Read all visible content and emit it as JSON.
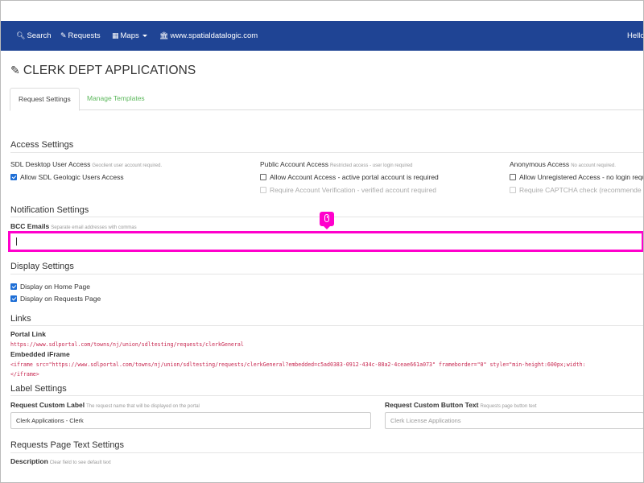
{
  "navbar": {
    "search": "Search",
    "requests": "Requests",
    "maps": "Maps",
    "website": "www.spatialdatalogic.com",
    "greeting": "Hello"
  },
  "page": {
    "title": "CLERK DEPT APPLICATIONS"
  },
  "tabs": [
    {
      "label": "Request Settings",
      "active": true
    },
    {
      "label": "Manage Templates",
      "active": false
    }
  ],
  "access": {
    "heading": "Access Settings",
    "sdl": {
      "label": "SDL Desktop User Access",
      "hint": "Geoclient user account required.",
      "options": [
        {
          "label": "Allow SDL Geologic Users Access",
          "checked": true
        }
      ]
    },
    "public": {
      "label": "Public Account Access",
      "hint": "Restricted access - user login required",
      "options": [
        {
          "label": "Allow Account Access - active portal account is required",
          "checked": false
        },
        {
          "label": "Require Account Verification - verified account required",
          "checked": false,
          "disabled": true
        }
      ]
    },
    "anonymous": {
      "label": "Anonymous Access",
      "hint": "No account required.",
      "options": [
        {
          "label": "Allow Unregistered Access - no login requ",
          "checked": false
        },
        {
          "label": "Require CAPTCHA check (recommende",
          "checked": false,
          "disabled": true
        }
      ]
    }
  },
  "notifications": {
    "heading": "Notification Settings",
    "bcc_label": "BCC Emails",
    "bcc_hint": "Separate email addresses with commas",
    "bcc_value": ""
  },
  "display": {
    "heading": "Display Settings",
    "options": [
      {
        "label": "Display on Home Page",
        "checked": true
      },
      {
        "label": "Display on Requests Page",
        "checked": true
      }
    ]
  },
  "links": {
    "heading": "Links",
    "portal_label": "Portal Link",
    "portal_url": "https://www.sdlportal.com/towns/nj/union/sdltesting/requests/clerkGeneral",
    "iframe_label": "Embedded iFrame",
    "iframe_code_line1": "<iframe src=\"https://www.sdlportal.com/towns/nj/union/sdltesting/requests/clerkGeneral?embedded=c5ad0383-0912-434c-88a2-4ceae661a073\" frameborder=\"0\" style=\"min-height:600px;width:",
    "iframe_code_line2": "</iframe>"
  },
  "label_settings": {
    "heading": "Label Settings",
    "custom_label": "Request Custom Label",
    "custom_label_hint": "The request name that will be displayed on the portal",
    "custom_label_value": "Clerk Applications - Clerk",
    "button_label": "Request Custom Button Text",
    "button_label_hint": "Requests page button text",
    "button_placeholder": "Clerk License Applications"
  },
  "requests_text": {
    "heading": "Requests Page Text Settings",
    "description_label": "Description",
    "description_hint": "Clear field to see default text"
  },
  "colors": {
    "navbar": "#1f4494",
    "highlight": "#ff00cc",
    "tab_link": "#5cb85c",
    "code": "#c7254e"
  }
}
